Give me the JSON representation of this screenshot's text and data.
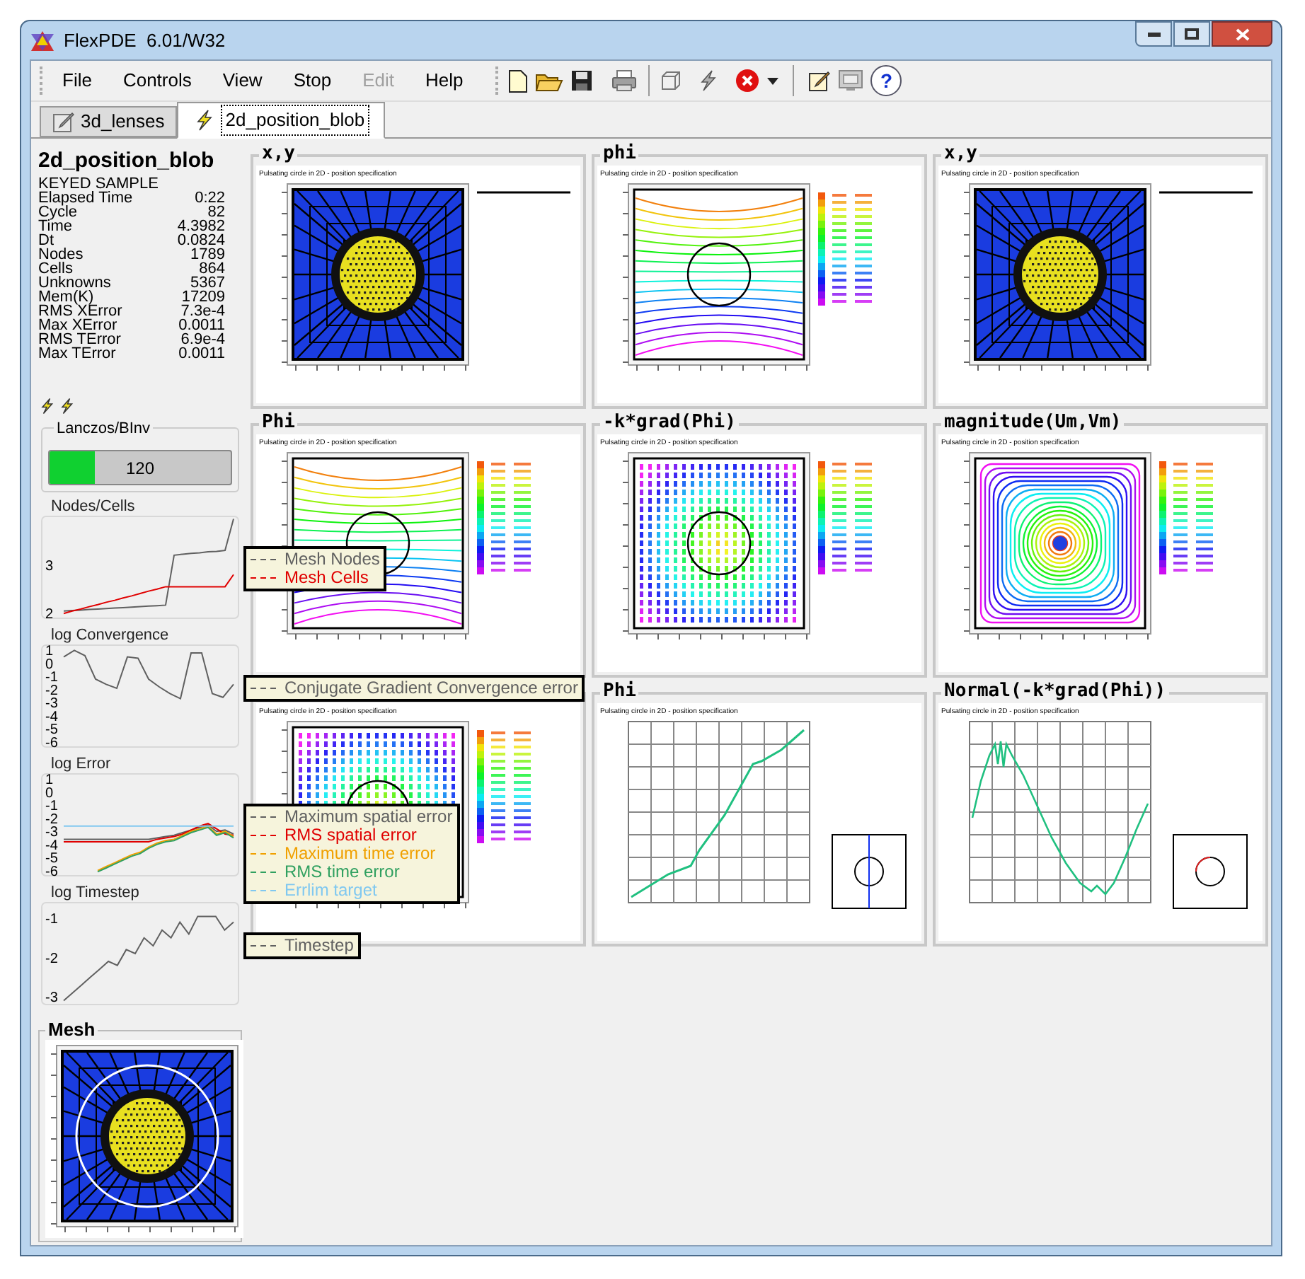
{
  "window": {
    "title": "FlexPDE  6.01/W32"
  },
  "menu": [
    {
      "label": "File",
      "disabled": false
    },
    {
      "label": "Controls",
      "disabled": false
    },
    {
      "label": "View",
      "disabled": false
    },
    {
      "label": "Stop",
      "disabled": false
    },
    {
      "label": "Edit",
      "disabled": true
    },
    {
      "label": "Help",
      "disabled": false
    }
  ],
  "toolbar": {
    "help_glyph": "?"
  },
  "tabs": [
    {
      "label": "3d_lenses",
      "selected": false,
      "kind": "edit"
    },
    {
      "label": "2d_position_blob",
      "selected": true,
      "kind": "run"
    }
  ],
  "status": {
    "title": "2d_position_blob",
    "subtitle": "KEYED SAMPLE",
    "rows": [
      {
        "label": "Elapsed Time",
        "value": "0:22"
      },
      {
        "label": "Cycle",
        "value": "82"
      },
      {
        "label": "Time",
        "value": "4.3982"
      },
      {
        "label": "Dt",
        "value": "0.0824"
      },
      {
        "label": "Nodes",
        "value": "1789"
      },
      {
        "label": "Cells",
        "value": "864"
      },
      {
        "label": "Unknowns",
        "value": "5367"
      },
      {
        "label": "Mem(K)",
        "value": "17209"
      },
      {
        "label": "RMS XError",
        "value": "7.3e-4"
      },
      {
        "label": "Max XError",
        "value": "0.0011"
      },
      {
        "label": "RMS TError",
        "value": "6.9e-4"
      },
      {
        "label": "Max TError",
        "value": "0.0011"
      }
    ]
  },
  "solver": {
    "title": "Lanczos/BInv",
    "value": "120",
    "level": 0.25
  },
  "charts": [
    {
      "title": "Nodes/Cells",
      "chart_data": {
        "type": "line",
        "ylim": [
          1.9,
          4.0
        ],
        "yticks": [
          2,
          3
        ],
        "series": [
          {
            "name": "Mesh Nodes",
            "color": "#606060",
            "values": [
              2.05,
              2.06,
              2.07,
              2.08,
              2.09,
              2.1,
              2.11,
              2.12,
              2.13,
              2.14,
              2.15,
              2.16,
              2.17,
              3.2,
              3.22,
              3.24,
              3.25,
              3.27,
              3.28,
              3.3,
              3.95
            ]
          },
          {
            "name": "Mesh Cells",
            "color": "#e00000",
            "values": [
              2.0,
              2.05,
              2.09,
              2.14,
              2.18,
              2.23,
              2.27,
              2.32,
              2.36,
              2.41,
              2.46,
              2.5,
              2.55,
              2.55,
              2.55,
              2.55,
              2.55,
              2.55,
              2.55,
              2.55,
              2.8
            ]
          }
        ]
      }
    },
    {
      "title": "log Convergence",
      "chart_data": {
        "type": "line",
        "ylim": [
          -6.4,
          1.4
        ],
        "yticks": [
          1,
          0,
          -1,
          -2,
          -3,
          -4,
          -5,
          -6
        ],
        "series": [
          {
            "name": "Conjugate Gradient Convergence error",
            "color": "#606060",
            "values": [
              0.5,
              1,
              0.6,
              -1.2,
              -1.6,
              -1.9,
              0.5,
              0.4,
              -1.2,
              -1.8,
              -2.3,
              -2.7,
              0.8,
              0.8,
              -2.3,
              -2.6,
              -1.6
            ]
          }
        ]
      }
    },
    {
      "title": "log Error",
      "chart_data": {
        "type": "line",
        "ylim": [
          -6.4,
          1.4
        ],
        "yticks": [
          1,
          0,
          -1,
          -2,
          -3,
          -4,
          -5,
          -6
        ],
        "series": [
          {
            "name": "Maximum spatial error",
            "color": "#606060",
            "values": [
              -3.6,
              -3.6,
              -3.6,
              -3.6,
              -3.6,
              -3.6,
              -3.6,
              -3.6,
              -3.6,
              -3.6,
              -3.6,
              -3.5,
              -3.4,
              -3.3,
              -3.1,
              -2.9,
              -2.7,
              -2.5,
              -3.0,
              -2.9,
              -3.2
            ]
          },
          {
            "name": "RMS spatial error",
            "color": "#e00000",
            "values": [
              -3.8,
              -3.8,
              -3.8,
              -3.8,
              -3.8,
              -3.8,
              -3.8,
              -3.8,
              -3.8,
              -3.8,
              -3.8,
              -3.6,
              -3.5,
              -3.4,
              -3.2,
              -2.9,
              -2.6,
              -2.4,
              -2.8,
              -3.2,
              -3.3
            ]
          },
          {
            "name": "Maximum time error",
            "color": "#f0a000",
            "values": [
              null,
              null,
              null,
              null,
              -6,
              -5.7,
              -5.4,
              -5.1,
              -4.8,
              -4.6,
              -4.2,
              -3.9,
              -3.7,
              -3.6,
              -3.3,
              -3.0,
              -2.8,
              -2.6,
              -3.2,
              -3.0,
              -3.4
            ]
          },
          {
            "name": "RMS time error",
            "color": "#30a060",
            "values": [
              null,
              null,
              null,
              null,
              -6.1,
              -5.8,
              -5.5,
              -5.2,
              -4.9,
              -4.7,
              -4.3,
              -4.0,
              -3.8,
              -3.7,
              -3.4,
              -3.1,
              -2.9,
              -2.7,
              -3.3,
              -3.1,
              -3.5
            ]
          },
          {
            "name": "Errlim target",
            "color": "#80c8f0",
            "values": [
              -2.6,
              -2.6,
              -2.6,
              -2.6,
              -2.6,
              -2.6,
              -2.6,
              -2.6,
              -2.6,
              -2.6,
              -2.6,
              -2.6,
              -2.6,
              -2.6,
              -2.6,
              -2.6,
              -2.6,
              -2.6,
              -2.6,
              -2.6,
              -2.6
            ]
          }
        ]
      }
    },
    {
      "title": "log Timestep",
      "chart_data": {
        "type": "line",
        "ylim": [
          -3.2,
          -0.6
        ],
        "yticks": [
          -1,
          -2,
          -3
        ],
        "series": [
          {
            "name": "Timestep",
            "color": "#606060",
            "values": [
              -3.1,
              -2.9,
              -2.7,
              -2.5,
              -2.3,
              -2.1,
              -2.2,
              -1.8,
              -1.9,
              -1.5,
              -1.7,
              -1.3,
              -1.5,
              -1.1,
              -1.4,
              -0.95,
              -0.95,
              -0.95,
              -1.3,
              -1.1
            ]
          }
        ]
      }
    }
  ],
  "plots": [
    {
      "title": "x,y",
      "subtitle": "Pulsating circle in 2D - position specification",
      "kind": "mesh"
    },
    {
      "title": "phi",
      "subtitle": "Pulsating circle in 2D - position specification",
      "kind": "contour"
    },
    {
      "title": "x,y",
      "subtitle": "Pulsating circle in 2D - position specification",
      "kind": "mesh"
    },
    {
      "title": "Phi",
      "subtitle": "Pulsating circle in 2D - position specification",
      "kind": "contour"
    },
    {
      "title": "-k*grad(Phi)",
      "subtitle": "Pulsating circle in 2D - position specification",
      "kind": "vector"
    },
    {
      "title": "magnitude(Um,Vm)",
      "subtitle": "Pulsating circle in 2D - position specification",
      "kind": "rings"
    },
    {
      "subtitle": "Pulsating circle in 2D - position specification",
      "kind": "vector"
    },
    {
      "title": "Phi",
      "subtitle": "Pulsating circle in 2D - position specification",
      "kind": "profile"
    },
    {
      "title": "Normal(-k*grad(Phi))",
      "subtitle": "Pulsating circle in 2D - position specification",
      "kind": "flux"
    }
  ],
  "mesh": {
    "title": "Mesh"
  }
}
